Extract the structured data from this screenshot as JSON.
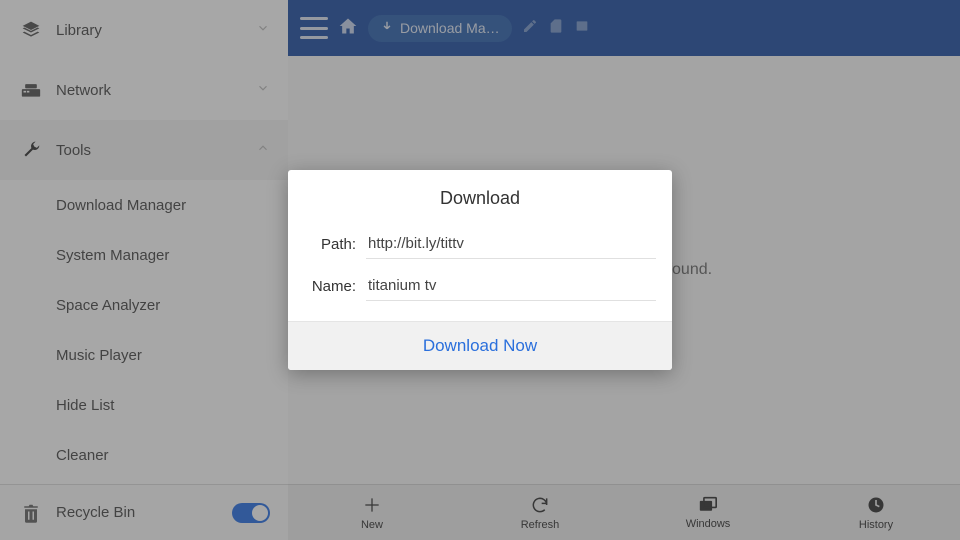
{
  "sidebar": {
    "library": "Library",
    "network": "Network",
    "tools": "Tools",
    "tools_items": [
      "Download Manager",
      "System Manager",
      "Space Analyzer",
      "Music Player",
      "Hide List",
      "Cleaner"
    ],
    "recycle_bin": "Recycle Bin"
  },
  "topbar": {
    "tab_label": "Download Ma…"
  },
  "main": {
    "no_task": "No download task found."
  },
  "bottom": {
    "new": "New",
    "refresh": "Refresh",
    "windows": "Windows",
    "history": "History"
  },
  "dialog": {
    "title": "Download",
    "path_label": "Path:",
    "path_value": "http://bit.ly/tittv",
    "name_label": "Name:",
    "name_value": "titanium tv",
    "action": "Download Now"
  }
}
